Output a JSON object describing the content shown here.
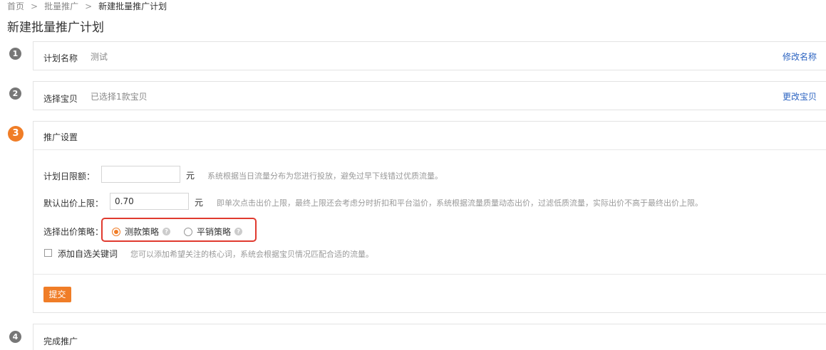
{
  "breadcrumb": {
    "items": [
      "首页",
      "批量推广",
      "新建批量推广计划"
    ],
    "separator": ">"
  },
  "page_title": "新建批量推广计划",
  "steps": [
    {
      "number": "1",
      "label": "计划名称",
      "value": "测试",
      "link": "修改名称"
    },
    {
      "number": "2",
      "label": "选择宝贝",
      "value": "已选择1款宝贝",
      "link": "更改宝贝"
    },
    {
      "number": "3",
      "label": "推广设置"
    },
    {
      "number": "4",
      "label": "完成推广"
    }
  ],
  "settings": {
    "daily_limit": {
      "label": "计划日限额：",
      "value": "",
      "unit": "元",
      "hint": "系统根据当日流量分布为您进行投放，避免过早下线错过优质流量。"
    },
    "max_bid": {
      "label": "默认出价上限：",
      "value": "0.70",
      "unit": "元",
      "hint": "即单次点击出价上限，最终上限还会考虑分时折扣和平台溢价，系统根据流量质量动态出价，过滤低质流量，实际出价不高于最终出价上限。"
    },
    "strategy": {
      "label": "选择出价策略：",
      "options": [
        {
          "label": "测款策略",
          "checked": true
        },
        {
          "label": "平销策略",
          "checked": false
        }
      ],
      "help_glyph": "?"
    },
    "keywords": {
      "label": "添加自选关键词",
      "checked": false,
      "hint": "您可以添加希望关注的核心词，系统会根据宝贝情况匹配合适的流量。"
    },
    "submit_label": "提交"
  },
  "colors": {
    "accent": "#f07d27",
    "link": "#2b63c1",
    "highlight": "#e03a2f"
  }
}
